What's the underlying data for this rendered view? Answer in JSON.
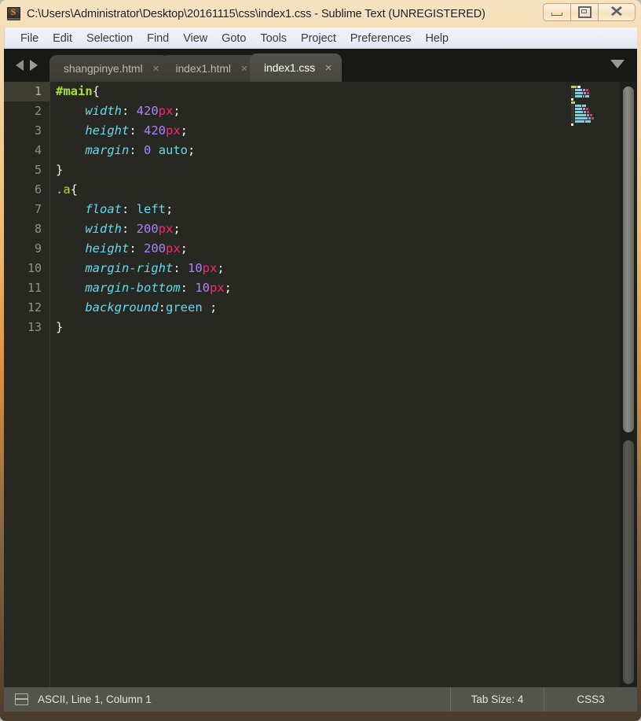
{
  "window": {
    "title": "C:\\Users\\Administrator\\Desktop\\20161115\\css\\index1.css - Sublime Text (UNREGISTERED)",
    "app_icon": "sublime-text-icon",
    "icon_letter": "S",
    "controls": {
      "minimize": "minimize-button",
      "maximize": "maximize-button",
      "close": "close-button"
    },
    "frame_color": "#e9a košice"
  },
  "menubar": {
    "items": [
      {
        "label": "File"
      },
      {
        "label": "Edit"
      },
      {
        "label": "Selection"
      },
      {
        "label": "Find"
      },
      {
        "label": "View"
      },
      {
        "label": "Goto"
      },
      {
        "label": "Tools"
      },
      {
        "label": "Project"
      },
      {
        "label": "Preferences"
      },
      {
        "label": "Help"
      }
    ]
  },
  "tabbar": {
    "nav_prev": "previous-tab-arrow",
    "nav_next": "next-tab-arrow",
    "menu_icon": "tab-dropdown-icon",
    "close_glyph": "×",
    "tabs": [
      {
        "label": "shangpinye.html",
        "active": false
      },
      {
        "label": "index1.html",
        "active": false
      },
      {
        "label": "index1.css",
        "active": true
      }
    ]
  },
  "editor": {
    "theme_background": "#272822",
    "active_line": 1,
    "line_numbers": [
      "1",
      "2",
      "3",
      "4",
      "5",
      "6",
      "7",
      "8",
      "9",
      "10",
      "11",
      "12",
      "13"
    ],
    "lines": [
      {
        "n": 1,
        "tokens": [
          {
            "t": "#main",
            "c": "tok-sel"
          },
          {
            "t": "{",
            "c": "tok-punct"
          }
        ]
      },
      {
        "n": 2,
        "tokens": [
          {
            "t": "    ",
            "c": "tok-punct"
          },
          {
            "t": "width",
            "c": "tok-prop"
          },
          {
            "t": ": ",
            "c": "tok-punct"
          },
          {
            "t": "420",
            "c": "tok-num"
          },
          {
            "t": "px",
            "c": "tok-unit"
          },
          {
            "t": ";",
            "c": "tok-punct"
          }
        ]
      },
      {
        "n": 3,
        "tokens": [
          {
            "t": "    ",
            "c": "tok-punct"
          },
          {
            "t": "height",
            "c": "tok-prop"
          },
          {
            "t": ": ",
            "c": "tok-punct"
          },
          {
            "t": "420",
            "c": "tok-num"
          },
          {
            "t": "px",
            "c": "tok-unit"
          },
          {
            "t": ";",
            "c": "tok-punct"
          }
        ]
      },
      {
        "n": 4,
        "tokens": [
          {
            "t": "    ",
            "c": "tok-punct"
          },
          {
            "t": "margin",
            "c": "tok-prop"
          },
          {
            "t": ": ",
            "c": "tok-punct"
          },
          {
            "t": "0",
            "c": "tok-num"
          },
          {
            "t": " ",
            "c": "tok-punct"
          },
          {
            "t": "auto",
            "c": "tok-val"
          },
          {
            "t": ";",
            "c": "tok-punct"
          }
        ]
      },
      {
        "n": 5,
        "tokens": [
          {
            "t": "}",
            "c": "tok-punct"
          }
        ]
      },
      {
        "n": 6,
        "tokens": [
          {
            "t": ".a",
            "c": "tok-class"
          },
          {
            "t": "{",
            "c": "tok-punct"
          }
        ]
      },
      {
        "n": 7,
        "tokens": [
          {
            "t": "    ",
            "c": "tok-punct"
          },
          {
            "t": "float",
            "c": "tok-prop"
          },
          {
            "t": ": ",
            "c": "tok-punct"
          },
          {
            "t": "left",
            "c": "tok-val"
          },
          {
            "t": ";",
            "c": "tok-punct"
          }
        ]
      },
      {
        "n": 8,
        "tokens": [
          {
            "t": "    ",
            "c": "tok-punct"
          },
          {
            "t": "width",
            "c": "tok-prop"
          },
          {
            "t": ": ",
            "c": "tok-punct"
          },
          {
            "t": "200",
            "c": "tok-num"
          },
          {
            "t": "px",
            "c": "tok-unit"
          },
          {
            "t": ";",
            "c": "tok-punct"
          }
        ]
      },
      {
        "n": 9,
        "tokens": [
          {
            "t": "    ",
            "c": "tok-punct"
          },
          {
            "t": "height",
            "c": "tok-prop"
          },
          {
            "t": ": ",
            "c": "tok-punct"
          },
          {
            "t": "200",
            "c": "tok-num"
          },
          {
            "t": "px",
            "c": "tok-unit"
          },
          {
            "t": ";",
            "c": "tok-punct"
          }
        ]
      },
      {
        "n": 10,
        "tokens": [
          {
            "t": "    ",
            "c": "tok-punct"
          },
          {
            "t": "margin-right",
            "c": "tok-prop"
          },
          {
            "t": ": ",
            "c": "tok-punct"
          },
          {
            "t": "10",
            "c": "tok-num"
          },
          {
            "t": "px",
            "c": "tok-unit"
          },
          {
            "t": ";",
            "c": "tok-punct"
          }
        ]
      },
      {
        "n": 11,
        "tokens": [
          {
            "t": "    ",
            "c": "tok-punct"
          },
          {
            "t": "margin-bottom",
            "c": "tok-prop"
          },
          {
            "t": ": ",
            "c": "tok-punct"
          },
          {
            "t": "10",
            "c": "tok-num"
          },
          {
            "t": "px",
            "c": "tok-unit"
          },
          {
            "t": ";",
            "c": "tok-punct"
          }
        ]
      },
      {
        "n": 12,
        "tokens": [
          {
            "t": "    ",
            "c": "tok-punct"
          },
          {
            "t": "background",
            "c": "tok-prop"
          },
          {
            "t": ":",
            "c": "tok-punct"
          },
          {
            "t": "green",
            "c": "tok-val"
          },
          {
            "t": " ;",
            "c": "tok-punct"
          }
        ]
      },
      {
        "n": 13,
        "tokens": [
          {
            "t": "}",
            "c": "tok-punct"
          }
        ]
      }
    ],
    "source_text": "#main{\n    width: 420px;\n    height: 420px;\n    margin: 0 auto;\n}\n.a{\n    float: left;\n    width: 200px;\n    height: 200px;\n    margin-right: 10px;\n    margin-bottom: 10px;\n    background:green ;\n}",
    "minimap": {
      "name": "minimap",
      "rows": [
        [
          {
            "w": 7,
            "color": "#a6e22e"
          },
          {
            "w": 4,
            "color": "#f8f8f2"
          }
        ],
        [
          {
            "w": 4,
            "color": "#3a3a33"
          },
          {
            "w": 9,
            "color": "#66d9ef"
          },
          {
            "w": 3,
            "color": "#ae81ff"
          },
          {
            "w": 3,
            "color": "#f92672"
          }
        ],
        [
          {
            "w": 4,
            "color": "#3a3a33"
          },
          {
            "w": 10,
            "color": "#66d9ef"
          },
          {
            "w": 3,
            "color": "#ae81ff"
          },
          {
            "w": 3,
            "color": "#f92672"
          }
        ],
        [
          {
            "w": 4,
            "color": "#3a3a33"
          },
          {
            "w": 9,
            "color": "#66d9ef"
          },
          {
            "w": 2,
            "color": "#ae81ff"
          },
          {
            "w": 5,
            "color": "#66d9ef"
          }
        ],
        [
          {
            "w": 3,
            "color": "#f8f8f2"
          }
        ],
        [
          {
            "w": 5,
            "color": "#a6e22e"
          }
        ],
        [
          {
            "w": 4,
            "color": "#3a3a33"
          },
          {
            "w": 8,
            "color": "#66d9ef"
          },
          {
            "w": 5,
            "color": "#66d9ef"
          }
        ],
        [
          {
            "w": 4,
            "color": "#3a3a33"
          },
          {
            "w": 9,
            "color": "#66d9ef"
          },
          {
            "w": 3,
            "color": "#ae81ff"
          },
          {
            "w": 3,
            "color": "#f92672"
          }
        ],
        [
          {
            "w": 4,
            "color": "#3a3a33"
          },
          {
            "w": 10,
            "color": "#66d9ef"
          },
          {
            "w": 3,
            "color": "#ae81ff"
          },
          {
            "w": 3,
            "color": "#f92672"
          }
        ],
        [
          {
            "w": 4,
            "color": "#3a3a33"
          },
          {
            "w": 14,
            "color": "#66d9ef"
          },
          {
            "w": 3,
            "color": "#ae81ff"
          },
          {
            "w": 3,
            "color": "#f92672"
          }
        ],
        [
          {
            "w": 4,
            "color": "#3a3a33"
          },
          {
            "w": 16,
            "color": "#66d9ef"
          },
          {
            "w": 3,
            "color": "#ae81ff"
          },
          {
            "w": 3,
            "color": "#f92672"
          }
        ],
        [
          {
            "w": 4,
            "color": "#3a3a33"
          },
          {
            "w": 12,
            "color": "#66d9ef"
          },
          {
            "w": 7,
            "color": "#66d9ef"
          }
        ],
        [
          {
            "w": 3,
            "color": "#f8f8f2"
          }
        ]
      ]
    },
    "scrollbar": "vertical-scrollbar"
  },
  "statusbar": {
    "panel_icon": "layout-panel-icon",
    "encoding_position": "ASCII, Line 1, Column 1",
    "tab_size": "Tab Size: 4",
    "syntax": "CSS3"
  }
}
